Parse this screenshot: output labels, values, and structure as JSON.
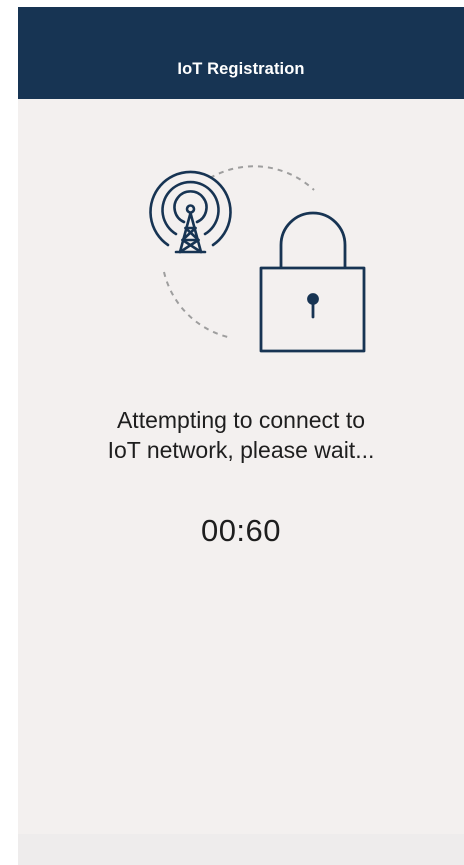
{
  "header": {
    "title": "IoT Registration"
  },
  "illustration": {
    "icons": [
      "radio-tower-icon",
      "padlock-icon"
    ]
  },
  "status": {
    "line1": "Attempting to connect to",
    "line2": "IoT network, please wait..."
  },
  "timer": {
    "value": "00:60"
  },
  "colors": {
    "header_bg": "#173453",
    "page_bg": "#f3f0ef",
    "icon_stroke": "#173453"
  }
}
